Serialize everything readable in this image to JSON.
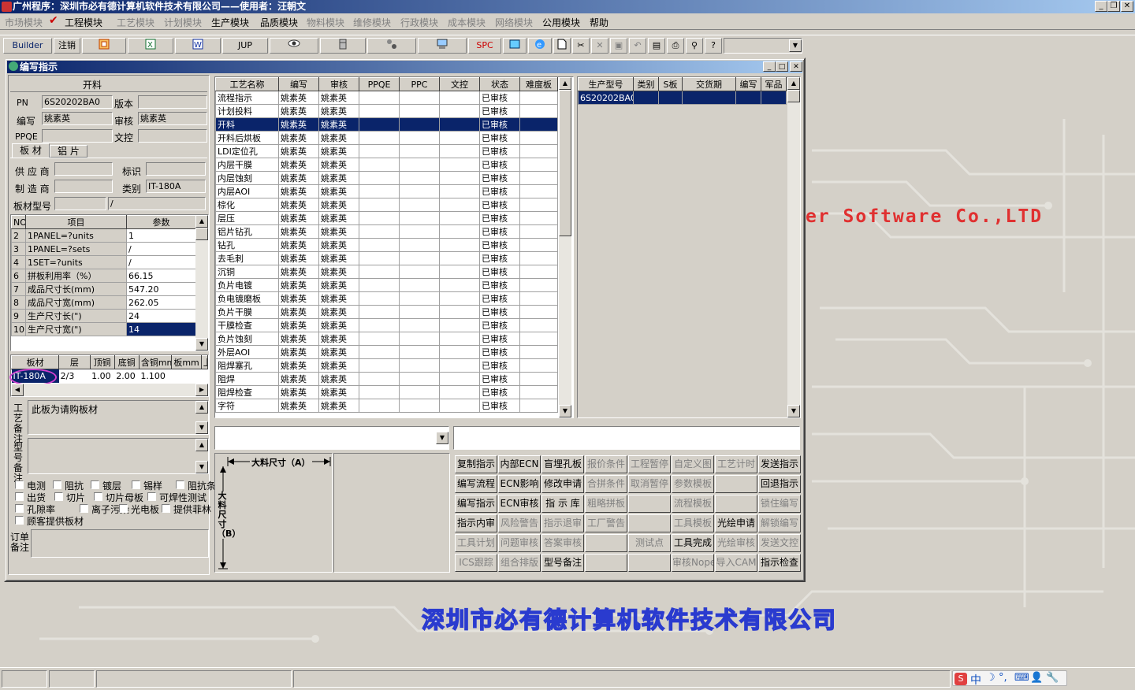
{
  "app": {
    "title": "广州程序：深圳市必有德计算机软件技术有限公司——使用者：汪朝文"
  },
  "menu": [
    {
      "label": "市场模块",
      "enabled": false
    },
    {
      "label": "工程模块",
      "enabled": true,
      "checked": true
    },
    {
      "label": "工艺模块",
      "enabled": false
    },
    {
      "label": "计划模块",
      "enabled": false
    },
    {
      "label": "生产模块",
      "enabled": true
    },
    {
      "label": "品质模块",
      "enabled": true
    },
    {
      "label": "物料模块",
      "enabled": false
    },
    {
      "label": "维修模块",
      "enabled": false
    },
    {
      "label": "行政模块",
      "enabled": false
    },
    {
      "label": "成本模块",
      "enabled": false
    },
    {
      "label": "网络模块",
      "enabled": false
    },
    {
      "label": "公用模块",
      "enabled": true
    },
    {
      "label": "帮助",
      "enabled": true
    }
  ],
  "toolbar": {
    "builder": "Builder",
    "logout": "注销",
    "jup": "JUP",
    "spc": "SPC",
    "icons": [
      "powerpoint-icon",
      "excel-icon",
      "word-icon",
      "eye-icon",
      "database-icon",
      "network-icon",
      "computer-icon",
      "exchange-icon",
      "ie-icon",
      "new-file-icon",
      "cut-icon",
      "delete-icon",
      "save-icon",
      "undo-icon",
      "preview-icon",
      "print-icon",
      "find-icon",
      "help-icon"
    ]
  },
  "window": {
    "title": "编写指示"
  },
  "left": {
    "section_title": "开料",
    "pn_label": "PN",
    "pn": "6S20202BA0",
    "version_label": "版本",
    "version": "",
    "author_label": "编写",
    "author": "姚素英",
    "reviewer_label": "审核",
    "reviewer": "姚素英",
    "ppqe_label": "PPQE",
    "ppqe": "",
    "docctrl_label": "文控",
    "docctrl": "",
    "tabs": [
      "板 材",
      "铝 片"
    ],
    "supplier_label": "供 应 商",
    "supplier": "",
    "mark_label": "标识",
    "mark": "",
    "maker_label": "制 造 商",
    "maker": "",
    "category_label": "类别",
    "category": "IT-180A",
    "model_label": "板材型号",
    "model": "",
    "model2": "/",
    "param_headers": [
      "NO",
      "项目",
      "参数"
    ],
    "params": [
      [
        "2",
        "1PANEL=?units",
        "1"
      ],
      [
        "3",
        "1PANEL=?sets",
        "/"
      ],
      [
        "4",
        "1SET=?units",
        "/"
      ],
      [
        "6",
        "拼板利用率（%）",
        "66.15"
      ],
      [
        "7",
        "成品尺寸长(mm)",
        "547.20"
      ],
      [
        "8",
        "成品尺寸宽(mm)",
        "262.05"
      ],
      [
        "9",
        "生产尺寸长(\")",
        "24"
      ],
      [
        "10",
        "生产尺寸宽(\")",
        "14"
      ]
    ],
    "board_headers": [
      "板材",
      "层",
      "顶铜",
      "底铜",
      "含铜mm",
      "板mm",
      "上"
    ],
    "board_row": [
      "IT-180A",
      "2/3",
      "1.00",
      "2.00",
      "1.100",
      "",
      ""
    ],
    "remark_label": "工艺备注",
    "remark_text": "此板为请购板材",
    "type_remark_label": "型号备注",
    "checks": [
      [
        "电测",
        "阻抗",
        "镀层",
        "锡样",
        "阻抗条"
      ],
      [
        "出货",
        "切片",
        "切片母板",
        "可焊性测试"
      ],
      [
        "孔隙率",
        "离子污染",
        "光电板",
        "提供菲林"
      ],
      [
        "顾客提供板材"
      ]
    ],
    "order_remark_label": "订单备注"
  },
  "process": {
    "headers": [
      "工艺名称",
      "编写",
      "审核",
      "PPQE",
      "PPC",
      "文控",
      "状态",
      "难度板"
    ],
    "rows": [
      [
        "流程指示",
        "姚素英",
        "姚素英",
        "",
        "",
        "",
        "已审核",
        ""
      ],
      [
        "计划投料",
        "姚素英",
        "姚素英",
        "",
        "",
        "",
        "已审核",
        ""
      ],
      [
        "开料",
        "姚素英",
        "姚素英",
        "",
        "",
        "",
        "已审核",
        ""
      ],
      [
        "开料后烘板",
        "姚素英",
        "姚素英",
        "",
        "",
        "",
        "已审核",
        ""
      ],
      [
        "LDI定位孔",
        "姚素英",
        "姚素英",
        "",
        "",
        "",
        "已审核",
        ""
      ],
      [
        "内层干膜",
        "姚素英",
        "姚素英",
        "",
        "",
        "",
        "已审核",
        ""
      ],
      [
        "内层蚀刻",
        "姚素英",
        "姚素英",
        "",
        "",
        "",
        "已审核",
        ""
      ],
      [
        "内层AOI",
        "姚素英",
        "姚素英",
        "",
        "",
        "",
        "已审核",
        ""
      ],
      [
        "棕化",
        "姚素英",
        "姚素英",
        "",
        "",
        "",
        "已审核",
        ""
      ],
      [
        "层压",
        "姚素英",
        "姚素英",
        "",
        "",
        "",
        "已审核",
        ""
      ],
      [
        "铝片钻孔",
        "姚素英",
        "姚素英",
        "",
        "",
        "",
        "已审核",
        ""
      ],
      [
        "钻孔",
        "姚素英",
        "姚素英",
        "",
        "",
        "",
        "已审核",
        ""
      ],
      [
        "去毛刺",
        "姚素英",
        "姚素英",
        "",
        "",
        "",
        "已审核",
        ""
      ],
      [
        "沉铜",
        "姚素英",
        "姚素英",
        "",
        "",
        "",
        "已审核",
        ""
      ],
      [
        "负片电镀",
        "姚素英",
        "姚素英",
        "",
        "",
        "",
        "已审核",
        ""
      ],
      [
        "负电镀磨板",
        "姚素英",
        "姚素英",
        "",
        "",
        "",
        "已审核",
        ""
      ],
      [
        "负片干膜",
        "姚素英",
        "姚素英",
        "",
        "",
        "",
        "已审核",
        ""
      ],
      [
        "干膜检查",
        "姚素英",
        "姚素英",
        "",
        "",
        "",
        "已审核",
        ""
      ],
      [
        "负片蚀刻",
        "姚素英",
        "姚素英",
        "",
        "",
        "",
        "已审核",
        ""
      ],
      [
        "外层AOI",
        "姚素英",
        "姚素英",
        "",
        "",
        "",
        "已审核",
        ""
      ],
      [
        "阻焊塞孔",
        "姚素英",
        "姚素英",
        "",
        "",
        "",
        "已审核",
        ""
      ],
      [
        "阻焊",
        "姚素英",
        "姚素英",
        "",
        "",
        "",
        "已审核",
        ""
      ],
      [
        "阻焊检查",
        "姚素英",
        "姚素英",
        "",
        "",
        "",
        "已审核",
        ""
      ],
      [
        "字符",
        "姚素英",
        "姚素英",
        "",
        "",
        "",
        "已审核",
        ""
      ]
    ],
    "selected_index": 2
  },
  "orders": {
    "headers": [
      "生产型号",
      "类别",
      "S板",
      "交货期",
      "编写",
      "军品"
    ],
    "rows": [
      [
        "6S20202BA0",
        "",
        "",
        "",
        "",
        ""
      ]
    ]
  },
  "dimension": {
    "a_label": "大料尺寸（A）",
    "b_label": "大料尺寸（B）"
  },
  "actions": [
    [
      [
        "复制指示",
        true
      ],
      [
        "内部ECN",
        true
      ],
      [
        "盲埋孔板",
        true
      ],
      [
        "报价条件",
        false
      ],
      [
        "工程暂停",
        false
      ],
      [
        "自定义图",
        false
      ],
      [
        "工艺计时",
        false
      ],
      [
        "发送指示",
        true
      ]
    ],
    [
      [
        "编写流程",
        true
      ],
      [
        "ECN影响",
        true
      ],
      [
        "修改申请",
        true
      ],
      [
        "合拼条件",
        false
      ],
      [
        "取消暂停",
        false
      ],
      [
        "参数模板",
        false
      ],
      [
        "",
        false
      ],
      [
        "回退指示",
        true
      ]
    ],
    [
      [
        "编写指示",
        true
      ],
      [
        "ECN审核",
        true
      ],
      [
        "指 示 库",
        true
      ],
      [
        "粗略拼板",
        false
      ],
      [
        "",
        false
      ],
      [
        "流程模板",
        false
      ],
      [
        "",
        false
      ],
      [
        "锁住编写",
        false
      ]
    ],
    [
      [
        "指示内审",
        true
      ],
      [
        "风险警告",
        false
      ],
      [
        "指示退审",
        false
      ],
      [
        "工厂警告",
        false
      ],
      [
        "",
        false
      ],
      [
        "工具模板",
        false
      ],
      [
        "光绘申请",
        true
      ],
      [
        "解锁编写",
        false
      ]
    ],
    [
      [
        "工具计划",
        false
      ],
      [
        "问题审核",
        false
      ],
      [
        "答案审核",
        false
      ],
      [
        "",
        false
      ],
      [
        "测试点",
        false
      ],
      [
        "工具完成",
        true
      ],
      [
        "光绘审核",
        false
      ],
      [
        "发送文控",
        false
      ]
    ],
    [
      [
        "ICS跟踪",
        false
      ],
      [
        "组合排版",
        false
      ],
      [
        "型号备注",
        true
      ],
      [
        "",
        false
      ],
      [
        "",
        false
      ],
      [
        "审核Nope",
        false
      ],
      [
        "导入CAM",
        false
      ],
      [
        "指示检查",
        true
      ]
    ]
  ],
  "watermark": {
    "english": "er Software Co.,LTD",
    "chinese": "深圳市必有德计算机软件技术有限公司"
  },
  "tray": {
    "ime": "中"
  }
}
